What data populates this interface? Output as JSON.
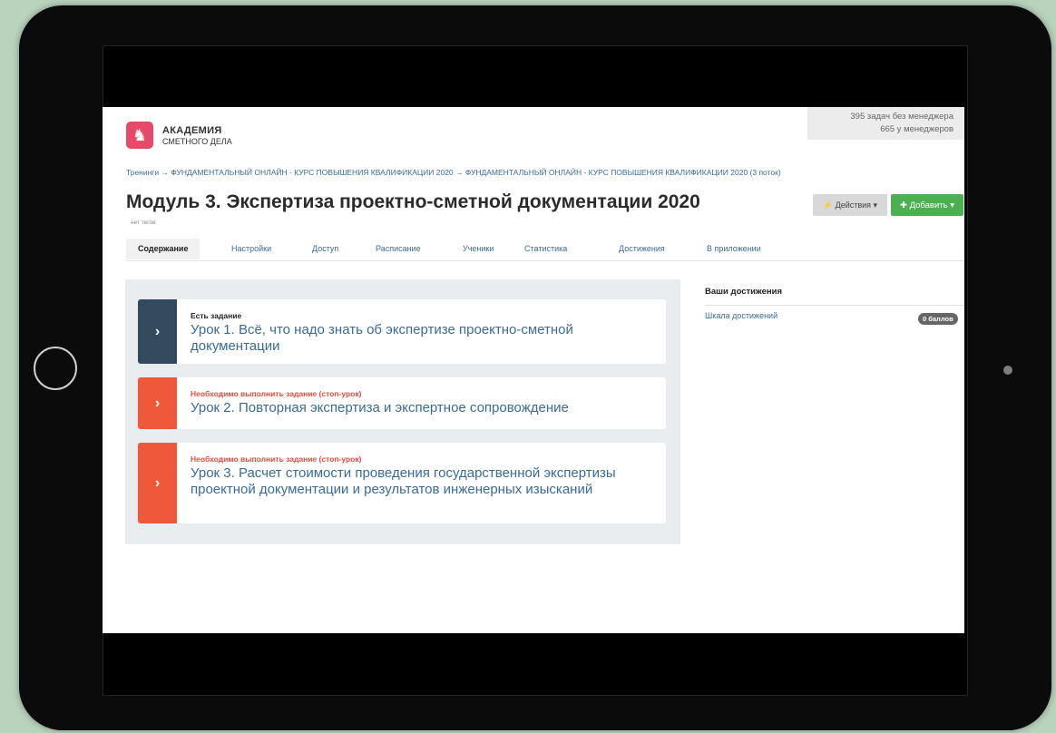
{
  "header": {
    "logo_icon": "lion-emblem",
    "brand_line1": "АКАДЕМИЯ",
    "brand_line2": "СМЕТНОГО ДЕЛА",
    "stats_line1": "395 задач без менеджера",
    "stats_line2": "665 у менеджеров"
  },
  "breadcrumb": "Тренинги → ФУНДАМЕНТАЛЬНЫЙ ОНЛАЙН - КУРС ПОВЫШЕНИЯ КВАЛИФИКАЦИИ 2020 → ФУНДАМЕНТАЛЬНЫЙ ОНЛАЙН - КУРС ПОВЫШЕНИЯ КВАЛИФИКАЦИИ 2020 (3 поток)",
  "page": {
    "title": "Модуль 3. Экспертиза проектно-сметной документации 2020",
    "tags": "нет тегов"
  },
  "toolbar": {
    "actions_label": "⚡ Действия ▾",
    "add_label": "✚ Добавить ▾",
    "add_color": "#4caf50"
  },
  "tabs": [
    {
      "label": "Содержание",
      "active": true
    },
    {
      "label": "Настройки"
    },
    {
      "label": "Доступ"
    },
    {
      "label": "Расписание"
    },
    {
      "label": "Ученики"
    },
    {
      "label": "Статистика"
    },
    {
      "label": "Достижения"
    },
    {
      "label": "В приложении"
    }
  ],
  "lessons": [
    {
      "status": "Есть задание",
      "title": "Урок 1. Всё, что надо знать об экспертизе проектно-сметной документации",
      "color": "#34495e",
      "status_color": "#222222"
    },
    {
      "status": "Необходимо выполнить задание (стоп-урок)",
      "title": "Урок 2. Повторная экспертиза и экспертное сопровождение",
      "color": "#f0583a",
      "status_color": "#e74c3c"
    },
    {
      "status": "Необходимо выполнить задание (стоп-урок)",
      "title": "Урок 3. Расчет стоимости проведения государственной экспертизы проектной документации и результатов инженерных изысканий",
      "color": "#f0583a",
      "status_color": "#e74c3c"
    }
  ],
  "achievements": {
    "heading": "Ваши достижения",
    "scale_link": "Шкала достижений",
    "points_badge": "0 баллов"
  }
}
